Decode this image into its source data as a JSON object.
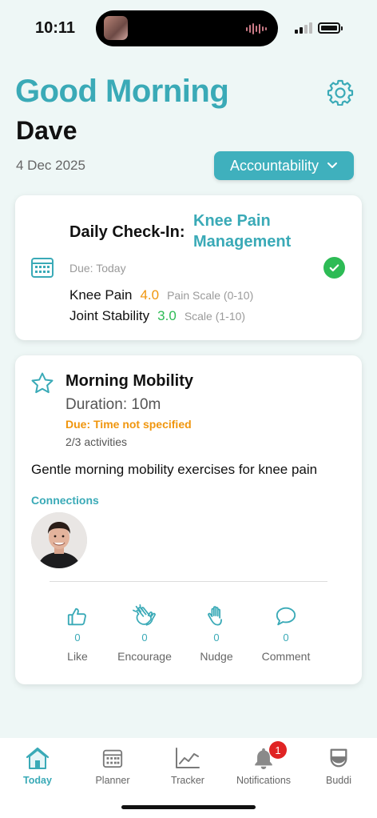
{
  "status_bar": {
    "time": "10:11"
  },
  "header": {
    "greeting": "Good Morning",
    "user_name": "Dave",
    "date": "4 Dec 2025",
    "accountability_label": "Accountability"
  },
  "checkin": {
    "label": "Daily Check-In:",
    "topic": "Knee Pain Management",
    "due": "Due: Today",
    "metrics": [
      {
        "name": "Knee Pain",
        "value": "4.0",
        "scale": "Pain Scale (0-10)",
        "color": "#f0960e"
      },
      {
        "name": "Joint Stability",
        "value": "3.0",
        "scale": "Scale (1-10)",
        "color": "#2dbb55"
      }
    ]
  },
  "activity": {
    "title": "Morning Mobility",
    "duration": "Duration: 10m",
    "due": "Due: Time not specified",
    "activities": "2/3 activities",
    "description": "Gentle morning mobility exercises for knee pain",
    "connections_label": "Connections",
    "reactions": [
      {
        "icon": "thumbs-up-icon",
        "count": "0",
        "label": "Like"
      },
      {
        "icon": "clapping-hands-icon",
        "count": "0",
        "label": "Encourage"
      },
      {
        "icon": "raised-hand-icon",
        "count": "0",
        "label": "Nudge"
      },
      {
        "icon": "speech-bubble-icon",
        "count": "0",
        "label": "Comment"
      }
    ]
  },
  "tabs": [
    {
      "label": "Today",
      "icon": "home-icon",
      "active": true
    },
    {
      "label": "Planner",
      "icon": "calendar-icon",
      "active": false
    },
    {
      "label": "Tracker",
      "icon": "line-chart-icon",
      "active": false
    },
    {
      "label": "Notifications",
      "icon": "bell-icon",
      "active": false,
      "badge": "1"
    },
    {
      "label": "Buddi",
      "icon": "buddi-icon",
      "active": false
    }
  ],
  "colors": {
    "accent": "#3aaab7",
    "background": "#eef7f6",
    "warning": "#f0960e",
    "success": "#2dbb55",
    "badge": "#e02424"
  }
}
